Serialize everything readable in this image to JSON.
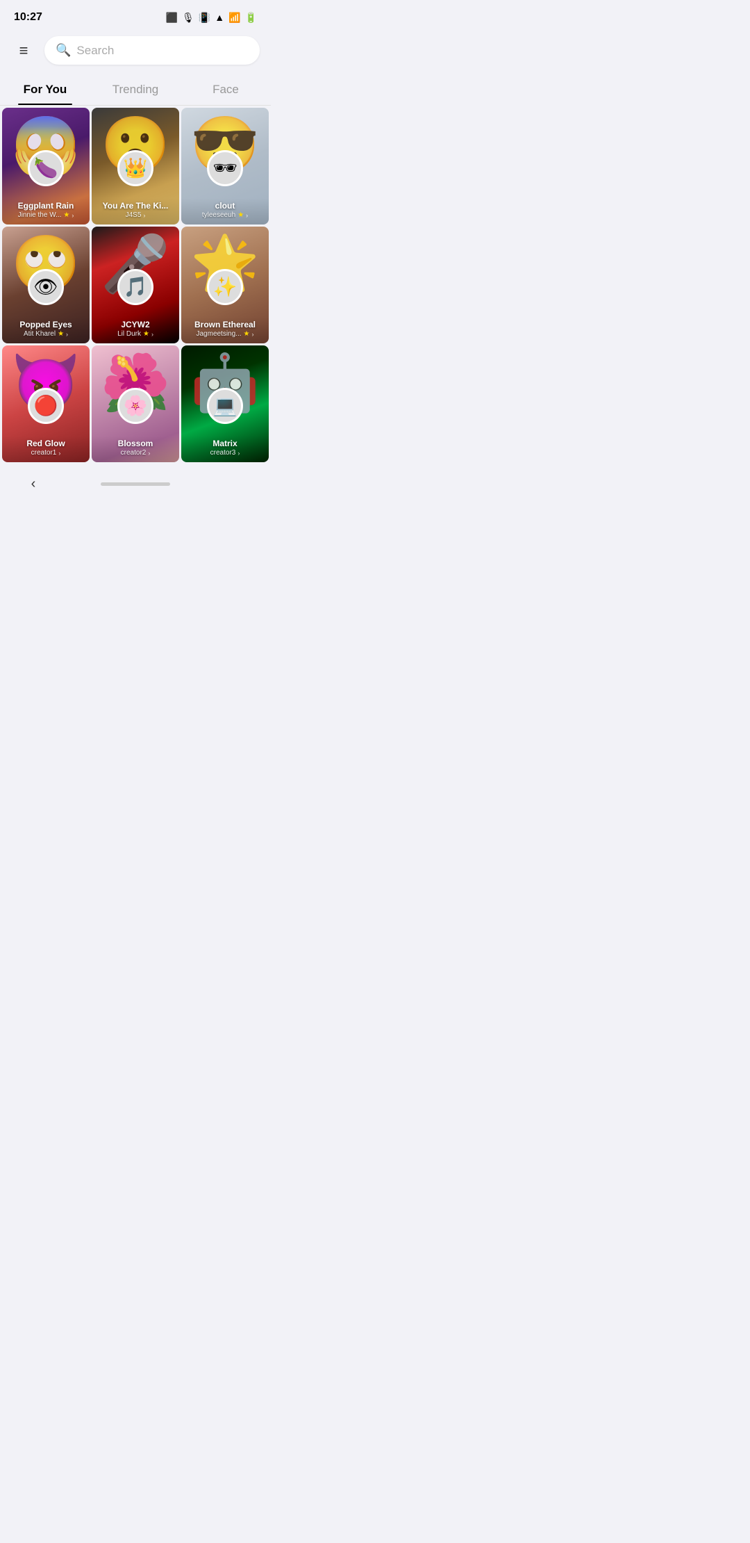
{
  "statusBar": {
    "time": "10:27",
    "icons": [
      "📋",
      "🎙",
      "📶",
      "🔋"
    ]
  },
  "header": {
    "backIcon": "≡",
    "searchPlaceholder": "Search"
  },
  "tabs": [
    {
      "id": "for-you",
      "label": "For You",
      "active": true
    },
    {
      "id": "trending",
      "label": "Trending",
      "active": false
    },
    {
      "id": "face",
      "label": "Face",
      "active": false
    }
  ],
  "filters": [
    {
      "id": "eggplant-rain",
      "title": "Eggplant Rain",
      "author": "Jinnie the W...",
      "verified": true,
      "avatarEmoji": "🍆",
      "bgClass": "card-bg-1",
      "faceEmoji": "😱"
    },
    {
      "id": "you-are-the-king",
      "title": "You Are The Ki...",
      "author": "J4S5",
      "verified": false,
      "avatarEmoji": "👑",
      "bgClass": "card-bg-2",
      "faceEmoji": "😮"
    },
    {
      "id": "clout",
      "title": "clout",
      "author": "tyleeseeuh",
      "verified": true,
      "avatarEmoji": "🕶",
      "bgClass": "card-bg-3",
      "faceEmoji": "😎"
    },
    {
      "id": "popped-eyes",
      "title": "Popped Eyes",
      "author": "Atit Kharel",
      "verified": true,
      "avatarEmoji": "👁",
      "bgClass": "card-bg-4",
      "faceEmoji": "🙄"
    },
    {
      "id": "jcyw2",
      "title": "JCYW2",
      "author": "Lil Durk",
      "verified": true,
      "avatarEmoji": "🎵",
      "bgClass": "card-bg-5",
      "faceEmoji": "🎤"
    },
    {
      "id": "brown-ethereal",
      "title": "Brown Ethereal",
      "author": "Jagmeetsing...",
      "verified": true,
      "avatarEmoji": "✨",
      "bgClass": "card-bg-6",
      "faceEmoji": "🌟"
    },
    {
      "id": "red-glow",
      "title": "Red Glow",
      "author": "creator1",
      "verified": false,
      "avatarEmoji": "🔴",
      "bgClass": "card-bg-7",
      "faceEmoji": "😈"
    },
    {
      "id": "blossom",
      "title": "Blossom",
      "author": "creator2",
      "verified": false,
      "avatarEmoji": "🌸",
      "bgClass": "card-bg-8",
      "faceEmoji": "🌺"
    },
    {
      "id": "matrix",
      "title": "Matrix",
      "author": "creator3",
      "verified": false,
      "avatarEmoji": "💻",
      "bgClass": "card-bg-9",
      "faceEmoji": "🤖"
    }
  ],
  "bottomNav": {
    "backLabel": "‹"
  }
}
